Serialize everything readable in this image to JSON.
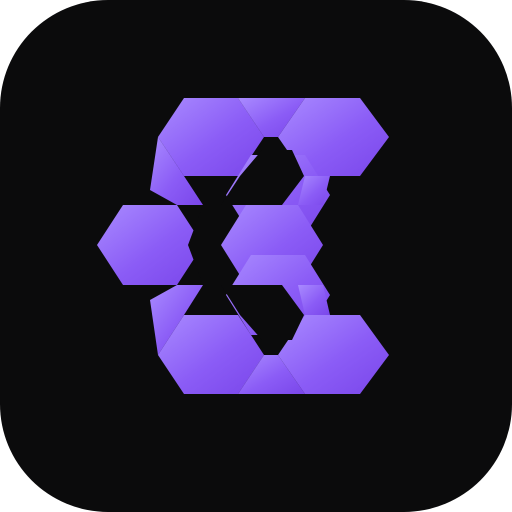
{
  "icon": {
    "name": "app-icon",
    "shape": "rounded-square",
    "logo": "hexagon-cluster-logo",
    "colors": {
      "background": "#0b0b0c",
      "outer": "#ffffff",
      "accent_light": "#a98bff",
      "accent_mid": "#8b5cf6",
      "accent_dark": "#7a46ea"
    }
  }
}
